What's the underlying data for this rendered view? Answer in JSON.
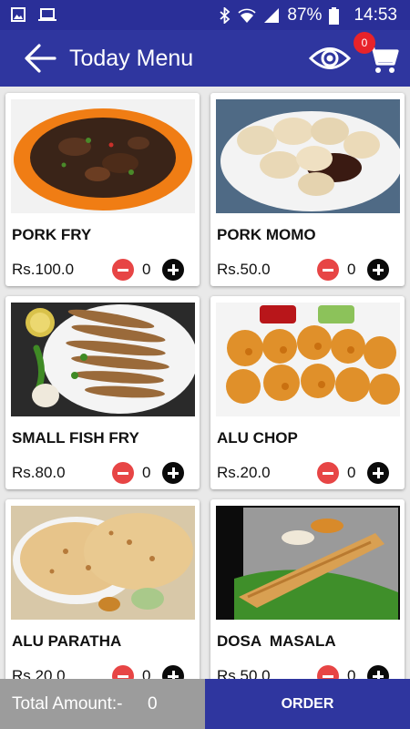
{
  "status_bar": {
    "battery": "87%",
    "time": "14:53",
    "icons": [
      "image-icon",
      "laptop-icon",
      "bluetooth-icon",
      "wifi-icon",
      "signal-icon",
      "battery-icon"
    ]
  },
  "app_bar": {
    "title": "Today Menu",
    "cart_count": "0",
    "icons": [
      "back-arrow-icon",
      "eye-icon",
      "cart-icon"
    ]
  },
  "menu": [
    {
      "name": "PORK FRY",
      "price": "Rs.100.0",
      "qty": "0"
    },
    {
      "name": "PORK MOMO",
      "price": "Rs.50.0",
      "qty": "0"
    },
    {
      "name": "SMALL FISH FRY",
      "price": "Rs.80.0",
      "qty": "0"
    },
    {
      "name": "ALU CHOP",
      "price": "Rs.20.0",
      "qty": "0"
    },
    {
      "name": "ALU PARATHA",
      "price": "Rs.20.0",
      "qty": "0"
    },
    {
      "name": "DOSA  MASALA",
      "price": "Rs.50.0",
      "qty": "0"
    }
  ],
  "footer": {
    "total_label": "Total Amount:-",
    "total_value": "0",
    "order_label": "ORDER"
  },
  "colors": {
    "primary": "#2f369f",
    "status_bar": "#2a2f98",
    "badge": "#e8232a",
    "minus": "#e74545",
    "plus": "#0a0a0a",
    "total_bg": "#9c9c9c"
  }
}
